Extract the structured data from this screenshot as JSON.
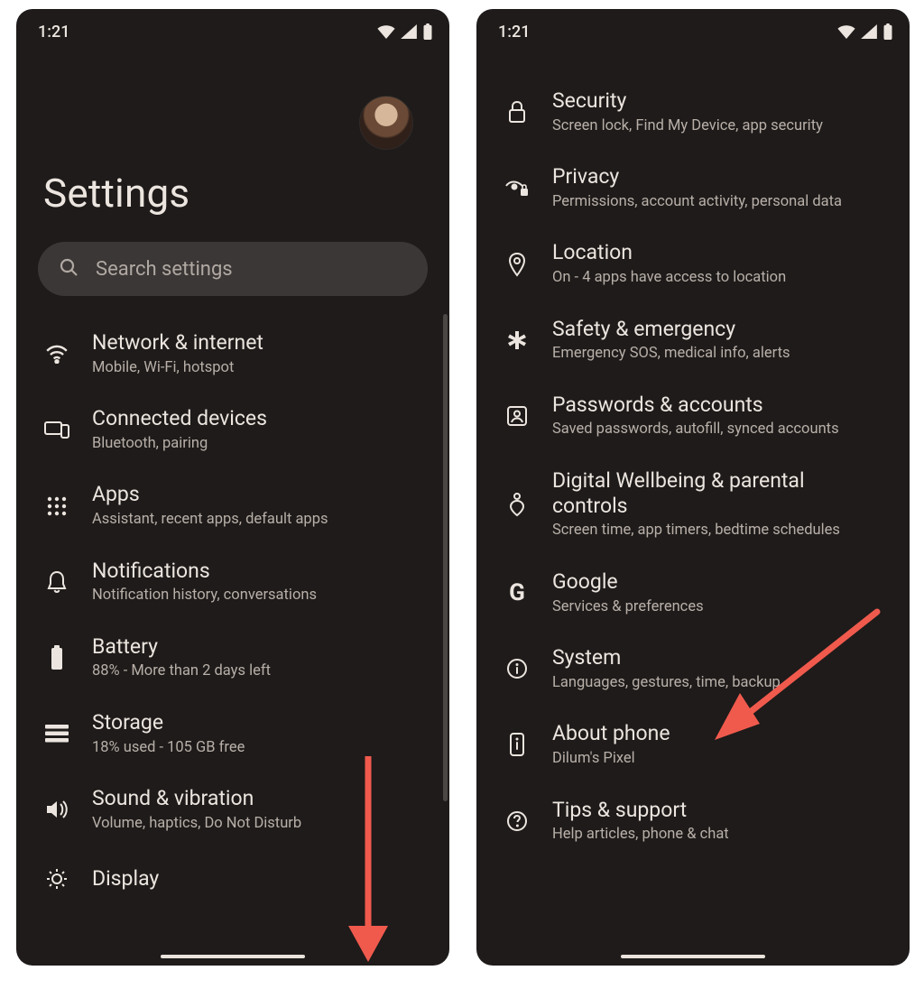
{
  "status": {
    "time": "1:21"
  },
  "left": {
    "page_title": "Settings",
    "search_placeholder": "Search settings",
    "items": [
      {
        "key": "network",
        "icon": "wifi",
        "title": "Network & internet",
        "subtitle": "Mobile, Wi-Fi, hotspot"
      },
      {
        "key": "connected",
        "icon": "devices",
        "title": "Connected devices",
        "subtitle": "Bluetooth, pairing"
      },
      {
        "key": "apps",
        "icon": "apps-grid",
        "title": "Apps",
        "subtitle": "Assistant, recent apps, default apps"
      },
      {
        "key": "notifications",
        "icon": "bell",
        "title": "Notifications",
        "subtitle": "Notification history, conversations"
      },
      {
        "key": "battery",
        "icon": "battery",
        "title": "Battery",
        "subtitle": "88% - More than 2 days left"
      },
      {
        "key": "storage",
        "icon": "storage",
        "title": "Storage",
        "subtitle": "18% used - 105 GB free"
      },
      {
        "key": "sound",
        "icon": "volume",
        "title": "Sound & vibration",
        "subtitle": "Volume, haptics, Do Not Disturb"
      },
      {
        "key": "display",
        "icon": "brightness",
        "title": "Display",
        "subtitle": ""
      }
    ]
  },
  "right": {
    "items": [
      {
        "key": "security",
        "icon": "lock",
        "title": "Security",
        "subtitle": "Screen lock, Find My Device, app security"
      },
      {
        "key": "privacy",
        "icon": "eye-lock",
        "title": "Privacy",
        "subtitle": "Permissions, account activity, personal data"
      },
      {
        "key": "location",
        "icon": "pin",
        "title": "Location",
        "subtitle": "On - 4 apps have access to location"
      },
      {
        "key": "safety",
        "icon": "asterisk",
        "title": "Safety & emergency",
        "subtitle": "Emergency SOS, medical info, alerts"
      },
      {
        "key": "passwords",
        "icon": "account-box",
        "title": "Passwords & accounts",
        "subtitle": "Saved passwords, autofill, synced accounts"
      },
      {
        "key": "wellbeing",
        "icon": "wellbeing",
        "title": "Digital Wellbeing & parental controls",
        "subtitle": "Screen time, app timers, bedtime schedules"
      },
      {
        "key": "google",
        "icon": "google-g",
        "title": "Google",
        "subtitle": "Services & preferences"
      },
      {
        "key": "system",
        "icon": "info",
        "title": "System",
        "subtitle": "Languages, gestures, time, backup"
      },
      {
        "key": "about",
        "icon": "phone-info",
        "title": "About phone",
        "subtitle": "Dilum's Pixel"
      },
      {
        "key": "tips",
        "icon": "help",
        "title": "Tips & support",
        "subtitle": "Help articles, phone & chat"
      }
    ]
  },
  "annotations": {
    "left_arrow": "scroll-down",
    "right_arrow": "tap-system"
  }
}
